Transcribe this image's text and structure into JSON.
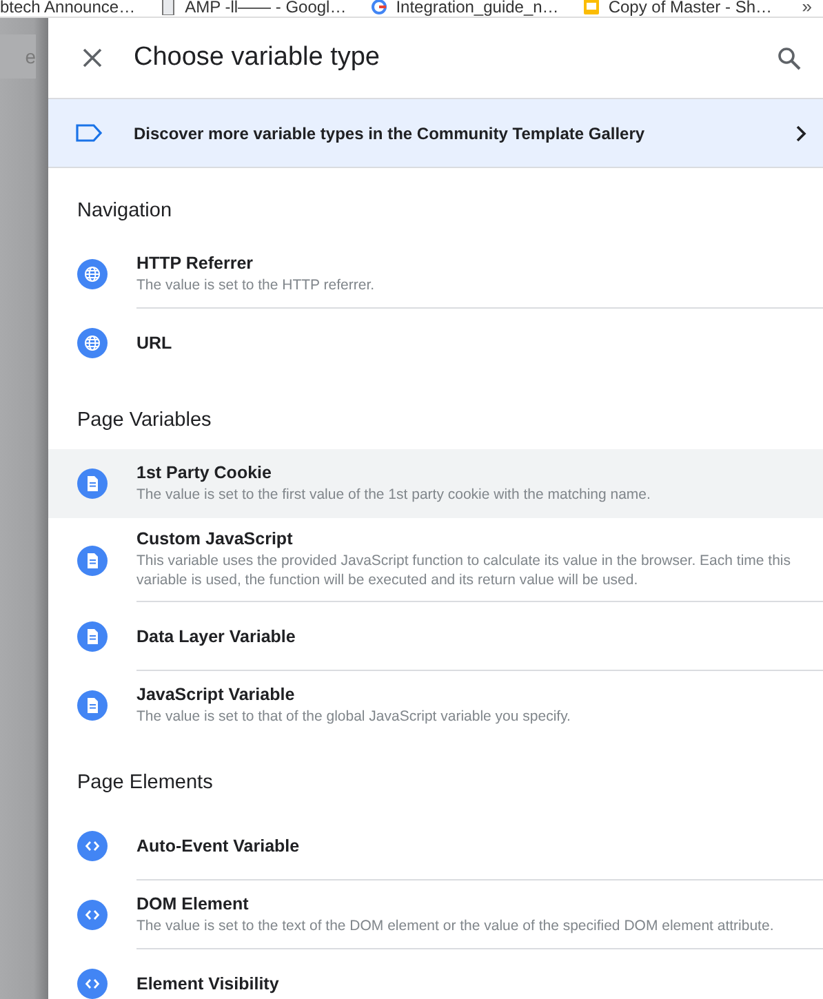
{
  "bookmarks": [
    {
      "label": "btech Announce…",
      "kind": "none"
    },
    {
      "label": "AMP -ll—— - Googl…",
      "kind": "doc"
    },
    {
      "label": "Integration_guide_n…",
      "kind": "g"
    },
    {
      "label": "Copy of Master - Sh…",
      "kind": "slides"
    }
  ],
  "bookmarks_more": "»",
  "backdrop": {
    "field_text": "e"
  },
  "dialog": {
    "title": "Choose variable type"
  },
  "banner": {
    "text": "Discover more variable types in the Community Template Gallery"
  },
  "sections": [
    {
      "heading": "Navigation",
      "items": [
        {
          "kind": "globe",
          "title": "HTTP Referrer",
          "description": "The value is set to the HTTP referrer.",
          "selected": false
        },
        {
          "kind": "globe",
          "title": "URL",
          "selected": false
        }
      ]
    },
    {
      "heading": "Page Variables",
      "items": [
        {
          "kind": "doc",
          "title": "1st Party Cookie",
          "description": "The value is set to the first value of the 1st party cookie with the matching name.",
          "selected": true
        },
        {
          "kind": "doc",
          "title": "Custom JavaScript",
          "description": "This variable uses the provided JavaScript function to calculate its value in the browser. Each time this variable is used, the function will be executed and its return value will be used.",
          "selected": false
        },
        {
          "kind": "doc",
          "title": "Data Layer Variable",
          "selected": false
        },
        {
          "kind": "doc",
          "title": "JavaScript Variable",
          "description": "The value is set to that of the global JavaScript variable you specify.",
          "selected": false
        }
      ]
    },
    {
      "heading": "Page Elements",
      "items": [
        {
          "kind": "code",
          "title": "Auto-Event Variable",
          "selected": false
        },
        {
          "kind": "code",
          "title": "DOM Element",
          "description": "The value is set to the text of the DOM element or the value of the specified DOM element attribute.",
          "selected": false
        },
        {
          "kind": "code",
          "title": "Element Visibility",
          "selected": false
        }
      ]
    }
  ]
}
